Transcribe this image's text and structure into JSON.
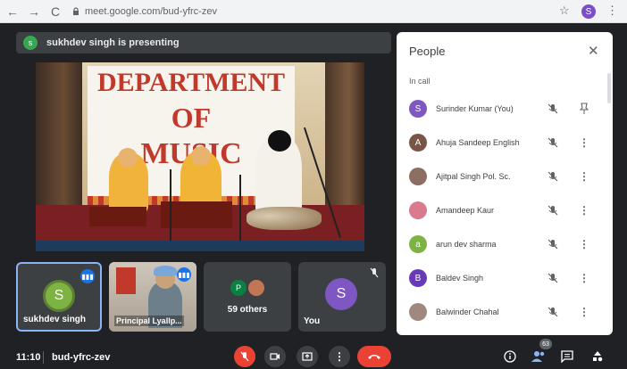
{
  "browser": {
    "url": "meet.google.com/bud-yfrc-zev",
    "profile_initial": "S",
    "colors": {
      "profile": "#7b4fc7"
    }
  },
  "banner": {
    "avatar_initial": "s",
    "text": "sukhdev singh is presenting"
  },
  "presentation": {
    "sign_line1": "DEPARTMENT",
    "sign_line2": "OF",
    "sign_line3": "MUSIC",
    "sign_partial": "LYA ALL"
  },
  "tiles": [
    {
      "name": "sukhdev singh",
      "initial": "S",
      "speaking": true
    },
    {
      "name": "Principal Lyallp...",
      "speaking": true
    },
    {
      "label": "59 others",
      "avatars": [
        "P",
        ""
      ]
    },
    {
      "name": "You",
      "initial": "S",
      "muted": true
    }
  ],
  "people_panel": {
    "title": "People",
    "section": "In call",
    "participants": [
      {
        "name": "Surinder Kumar (You)",
        "initial": "S",
        "color": "#7e57c2",
        "action": "pin-icon"
      },
      {
        "name": "Ahuja Sandeep English",
        "initial": "A",
        "color": "#795548",
        "action": "more-icon"
      },
      {
        "name": "Ajitpal Singh Pol. Sc.",
        "initial": "",
        "color": "#8d6e63",
        "action": "more-icon"
      },
      {
        "name": "Amandeep Kaur",
        "initial": "",
        "color": "#d97a8f",
        "action": "more-icon"
      },
      {
        "name": "arun dev sharma",
        "initial": "a",
        "color": "#7cb342",
        "action": "more-icon"
      },
      {
        "name": "Baldev Singh",
        "initial": "B",
        "color": "#673ab7",
        "action": "more-icon"
      },
      {
        "name": "Balwinder Chahal",
        "initial": "",
        "color": "#a1887f",
        "action": "more-icon"
      }
    ]
  },
  "bottom_bar": {
    "time": "11:10",
    "meeting_code": "bud-yfrc-zev",
    "participant_count": "63",
    "more_glyph": "⋮"
  }
}
